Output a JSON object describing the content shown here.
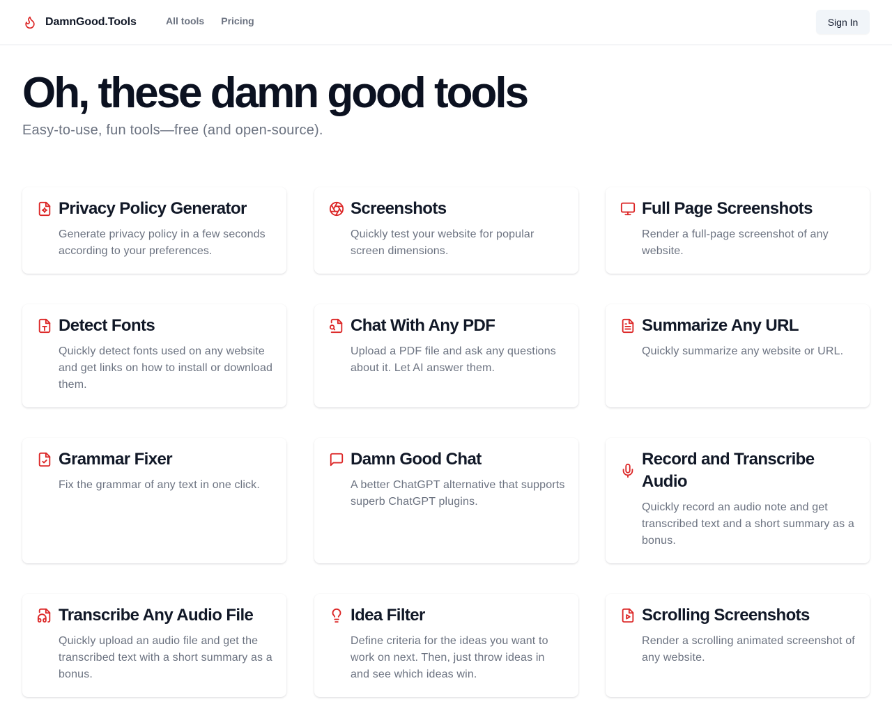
{
  "brand": {
    "name": "DamnGood.Tools",
    "accent": "#dc2626"
  },
  "nav": {
    "items": [
      "All tools",
      "Pricing"
    ]
  },
  "header": {
    "signin_label": "Sign In"
  },
  "hero": {
    "title": "Oh, these damn good tools",
    "subtitle": "Easy-to-use, fun tools—free (and open-source)."
  },
  "tools": [
    {
      "icon": "file-cog-icon",
      "title": "Privacy Policy Generator",
      "description": "Generate privacy policy in a few seconds according to your preferences."
    },
    {
      "icon": "aperture-icon",
      "title": "Screenshots",
      "description": "Quickly test your website for popular screen dimensions."
    },
    {
      "icon": "monitor-icon",
      "title": "Full Page Screenshots",
      "description": "Render a full-page screenshot of any website."
    },
    {
      "icon": "file-type-icon",
      "title": "Detect Fonts",
      "description": "Quickly detect fonts used on any website and get links on how to install or download them."
    },
    {
      "icon": "file-search-icon",
      "title": "Chat With Any PDF",
      "description": "Upload a PDF file and ask any questions about it. Let AI answer them."
    },
    {
      "icon": "file-text-icon",
      "title": "Summarize Any URL",
      "description": "Quickly summarize any website or URL."
    },
    {
      "icon": "file-check-icon",
      "title": "Grammar Fixer",
      "description": "Fix the grammar of any text in one click."
    },
    {
      "icon": "message-square-icon",
      "title": "Damn Good Chat",
      "description": "A better ChatGPT alternative that supports superb ChatGPT plugins."
    },
    {
      "icon": "mic-icon",
      "title": "Record and Transcribe Audio",
      "description": "Quickly record an audio note and get transcribed text and a short summary as a bonus."
    },
    {
      "icon": "file-audio-icon",
      "title": "Transcribe Any Audio File",
      "description": "Quickly upload an audio file and get the transcribed text with a short summary as a bonus."
    },
    {
      "icon": "lightbulb-icon",
      "title": "Idea Filter",
      "description": "Define criteria for the ideas you want to work on next. Then, just throw ideas in and see which ideas win."
    },
    {
      "icon": "file-video-icon",
      "title": "Scrolling Screenshots",
      "description": "Render a scrolling animated screenshot of any website."
    }
  ]
}
